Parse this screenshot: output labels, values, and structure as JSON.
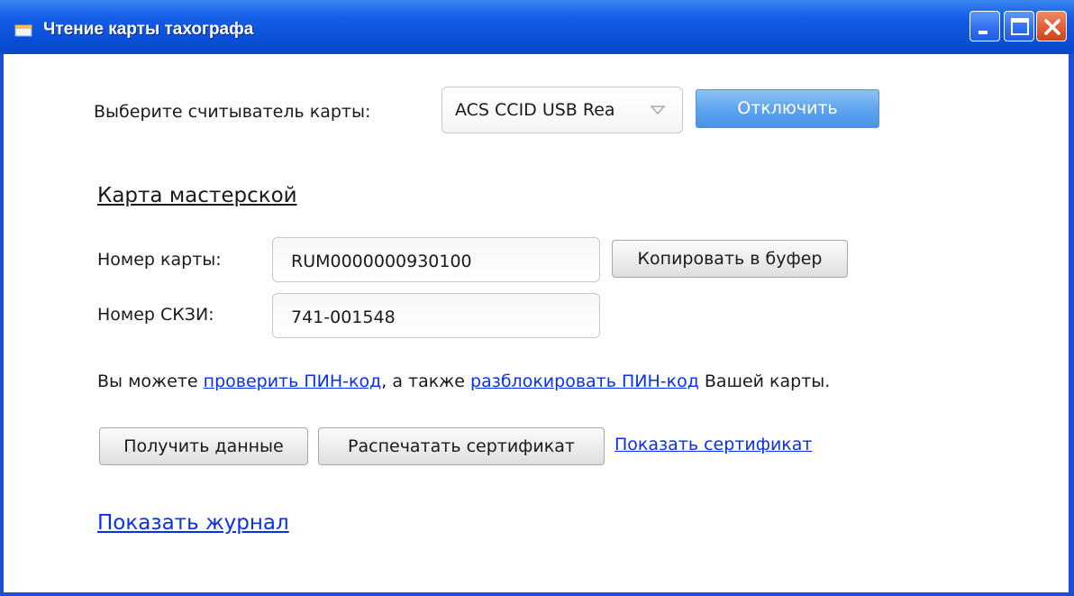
{
  "window": {
    "title": "Чтение карты тахографа"
  },
  "reader": {
    "label": "Выберите считыватель карты:",
    "selected": "ACS CCID USB Rea",
    "disconnect_label": "Отключить"
  },
  "card": {
    "heading": "Карта мастерской",
    "number_label": "Номер карты:",
    "number_value": "RUM0000000930100",
    "copy_label": "Копировать в буфер",
    "skzi_label": "Номер СКЗИ:",
    "skzi_value": "741-001548"
  },
  "pin": {
    "text_before": "Вы можете ",
    "check_link": "проверить ПИН-код",
    "text_middle": ", а также ",
    "unlock_link": "разблокировать ПИН-код",
    "text_after": " Вашей карты."
  },
  "actions": {
    "get_data": "Получить данные",
    "print_cert": "Распечатать сертификат",
    "show_cert": "Показать сертификат"
  },
  "log": {
    "show_label": "Показать журнал"
  },
  "colors": {
    "titlebar": "#0b4fd8",
    "link": "#0b2ff0",
    "accent_button": "#5ea4ee"
  }
}
